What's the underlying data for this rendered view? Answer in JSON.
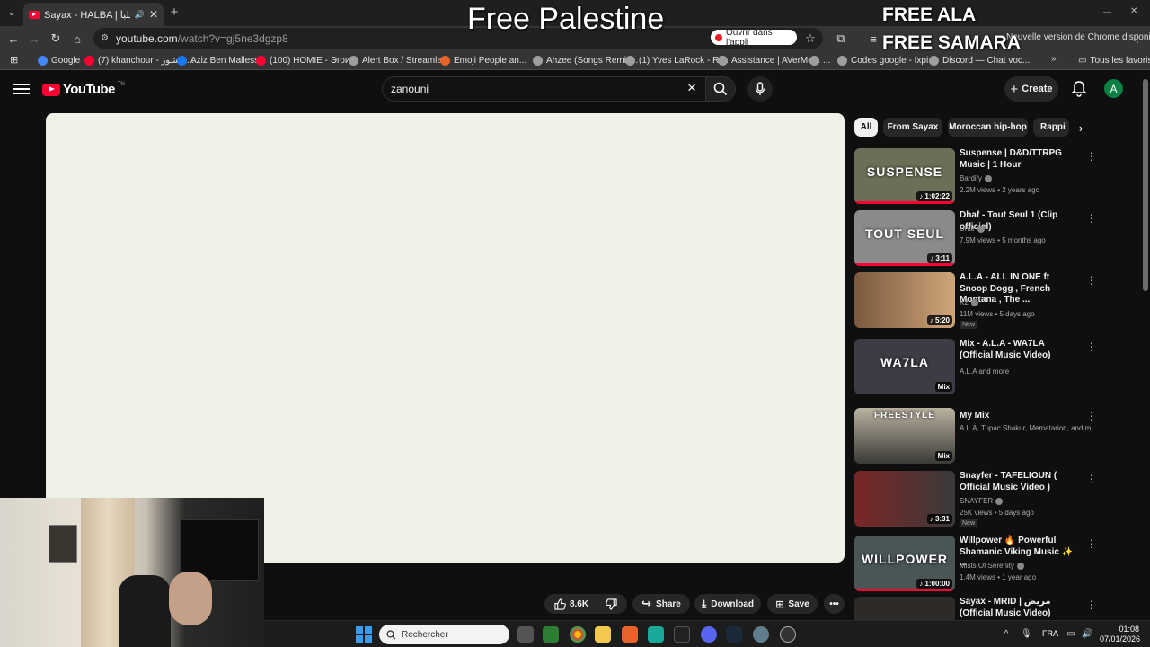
{
  "browser": {
    "tab_title": "Sayax - HALBA | هلبا (Offici",
    "url_host": "youtube.com",
    "url_path": "/watch?v=gj5ne3dgzp8",
    "open_app_label": "Ouvrir dans l'appli",
    "update_text": "Nouvelle version de Chrome disponible"
  },
  "overlay": {
    "main": "Free Palestine",
    "line1": "FREE ALA",
    "line2": "FREE SAMARA"
  },
  "bookmarks": [
    {
      "label": "Google",
      "color": "#4285f4"
    },
    {
      "label": "(7) khanchour - خنشور...",
      "color": "#ff0033"
    },
    {
      "label": "Aziz Ben Mallessa",
      "color": "#1877f2"
    },
    {
      "label": "(100) HOMIE - Эгои...",
      "color": "#ff0033"
    },
    {
      "label": "Alert Box / Streamla...",
      "color": "#9e9e9e"
    },
    {
      "label": "Emoji People an...",
      "color": "#e8632b"
    },
    {
      "label": "Ahzee (Songs Remix...",
      "color": "#9e9e9e"
    },
    {
      "label": "(1) Yves LaRock - Ri...",
      "color": "#9e9e9e"
    },
    {
      "label": "Assistance | AVerMe...",
      "color": "#9e9e9e"
    },
    {
      "label": "...",
      "color": "#9e9e9e"
    },
    {
      "label": "Codes google - fxpi...",
      "color": "#9e9e9e"
    },
    {
      "label": "Discord — Chat voc...",
      "color": "#9e9e9e"
    },
    {
      "label": "Tous les favoris",
      "color": "#9e9e9e"
    }
  ],
  "youtube": {
    "wordmark": "YouTube",
    "region": "TN",
    "search_query": "zanouni",
    "create_label": "Create",
    "avatar_letter": "A"
  },
  "actions": {
    "likes": "8.6K",
    "share": "Share",
    "download": "Download",
    "save": "Save"
  },
  "chips": [
    "All",
    "From Sayax",
    "Moroccan hip-hop",
    "Rappi"
  ],
  "recommendations": [
    {
      "title": "Suspense | D&D/TTRPG Music | 1 Hour",
      "channel": "Bardify",
      "verified": true,
      "meta": "2.2M views • 2 years ago",
      "badge": "♪ 1:02:22",
      "thumb_text": "SUSPENSE",
      "new": "",
      "thumb_color": "#6b6f57",
      "progress": 1.0
    },
    {
      "title": "Dhaf - Tout Seul 1 (Clip officiel)",
      "channel": "Dhaf",
      "verified": true,
      "meta": "7.9M views • 5 months ago",
      "badge": "♪ 3:11",
      "thumb_text": "TOUT SEUL",
      "new": "",
      "thumb_color": "#8a8a8a",
      "progress": 1.0
    },
    {
      "title": "A.L.A - ALL IN ONE ft Snoop Dogg , French Montana , The ...",
      "channel": "K2",
      "verified": true,
      "meta": "11M views • 5 days ago",
      "badge": "♪ 5:20",
      "thumb_text": "",
      "new": "New",
      "thumb_color": "#b5865a",
      "progress": 0
    },
    {
      "title": "Mix - A.L.A - WA7LA (Official Music Video)",
      "channel": "A.L.A and more",
      "verified": false,
      "meta": "",
      "badge": "Mix",
      "thumb_text": "WA7LA",
      "new": "",
      "thumb_color": "#3c3c44",
      "progress": 0
    },
    {
      "title": "My Mix",
      "channel": "A.L.A, Tupac Shakur, Mematarion, and m...",
      "verified": false,
      "meta": "",
      "badge": "Mix",
      "thumb_text": "FREESTYLE",
      "new": "",
      "thumb_color": "#c9c2b0",
      "progress": 0
    },
    {
      "title": "Snayfer - TAFELIOUN ( Official Music Video )",
      "channel": "SNAYFER",
      "verified": true,
      "meta": "25K views • 5 days ago",
      "badge": "♪ 3:31",
      "thumb_text": "",
      "new": "New",
      "thumb_color": "#5a3d3d",
      "progress": 0
    },
    {
      "title": "Willpower 🔥 Powerful Shamanic Viking Music ✨ ...",
      "channel": "Mists Of Serenity",
      "verified": true,
      "meta": "1.4M views • 1 year ago",
      "badge": "♪ 1:00:00",
      "thumb_text": "WILLPOWER",
      "new": "",
      "thumb_color": "#4a5556",
      "progress": 1.0
    },
    {
      "title": "Sayax - MRID | مريض (Official Music Video)",
      "channel": "",
      "verified": false,
      "meta": "",
      "badge": "",
      "thumb_text": "",
      "new": "",
      "thumb_color": "#2e2a28",
      "progress": 0
    }
  ],
  "taskbar": {
    "search_placeholder": "Rechercher",
    "lang": "FRA",
    "time": "01:08",
    "date": "07/01/2026"
  },
  "colors": {
    "accent_red": "#ff0033",
    "bg": "#0f0f0f",
    "player_bg": "#eef1e5"
  }
}
